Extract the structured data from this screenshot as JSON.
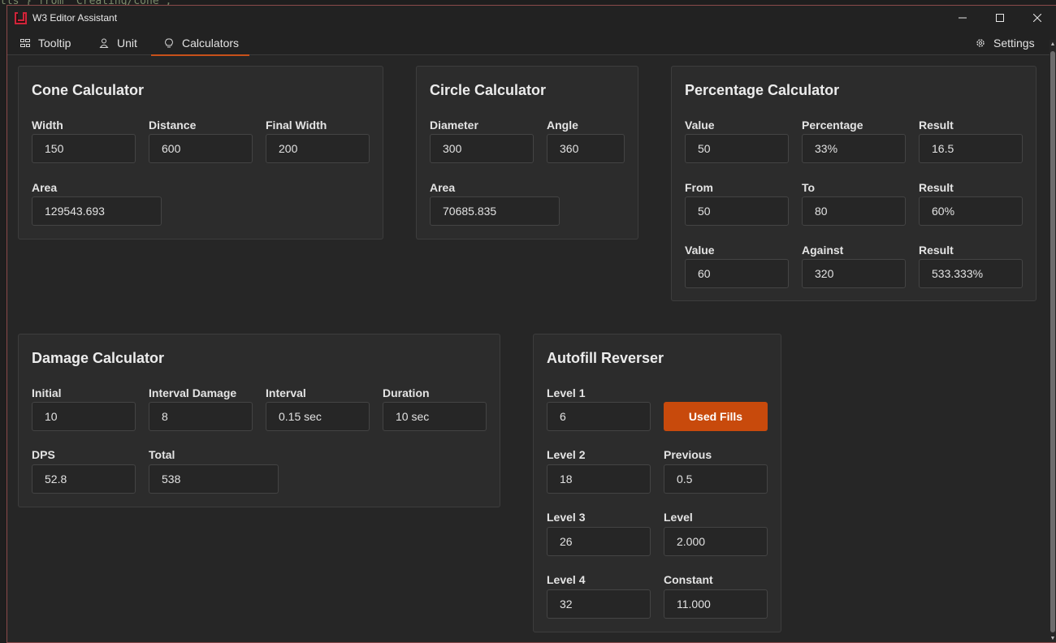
{
  "window": {
    "title": "W3 Editor Assistant",
    "controls": {
      "minimize": "—",
      "maximize": "☐",
      "close": "✕"
    }
  },
  "tabs": [
    {
      "label": "Tooltip",
      "icon": "tooltip-icon"
    },
    {
      "label": "Unit",
      "icon": "user-icon"
    },
    {
      "label": "Calculators",
      "icon": "lightbulb-icon",
      "active": true
    }
  ],
  "settings": {
    "label": "Settings",
    "icon": "gear-icon"
  },
  "accent_color": "#c84a0c",
  "cone": {
    "title": "Cone Calculator",
    "width_label": "Width",
    "width": "150",
    "distance_label": "Distance",
    "distance": "600",
    "final_width_label": "Final Width",
    "final_width": "200",
    "area_label": "Area",
    "area": "129543.693"
  },
  "circle": {
    "title": "Circle Calculator",
    "diameter_label": "Diameter",
    "diameter": "300",
    "angle_label": "Angle",
    "angle": "360",
    "area_label": "Area",
    "area": "70685.835"
  },
  "percentage": {
    "title": "Percentage Calculator",
    "rows": [
      {
        "l1": "Value",
        "v1": "50",
        "l2": "Percentage",
        "v2": "33%",
        "l3": "Result",
        "v3": "16.5"
      },
      {
        "l1": "From",
        "v1": "50",
        "l2": "To",
        "v2": "80",
        "l3": "Result",
        "v3": "60%"
      },
      {
        "l1": "Value",
        "v1": "60",
        "l2": "Against",
        "v2": "320",
        "l3": "Result",
        "v3": "533.333%"
      }
    ]
  },
  "damage": {
    "title": "Damage Calculator",
    "initial_label": "Initial",
    "initial": "10",
    "interval_damage_label": "Interval Damage",
    "interval_damage": "8",
    "interval_label": "Interval",
    "interval": "0.15 sec",
    "duration_label": "Duration",
    "duration": "10 sec",
    "dps_label": "DPS",
    "dps": "52.8",
    "total_label": "Total",
    "total": "538"
  },
  "autofill": {
    "title": "Autofill Reverser",
    "button": "Used Fills",
    "level1_label": "Level 1",
    "level1": "6",
    "level2_label": "Level 2",
    "level2": "18",
    "previous_label": "Previous",
    "previous": "0.5",
    "level3_label": "Level 3",
    "level3": "26",
    "level_label": "Level",
    "level": "2.000",
    "level4_label": "Level 4",
    "level4": "32",
    "constant_label": "Constant",
    "constant": "11.000"
  },
  "background_code": {
    "line1": "tls } from \"Creating/cone\";"
  }
}
